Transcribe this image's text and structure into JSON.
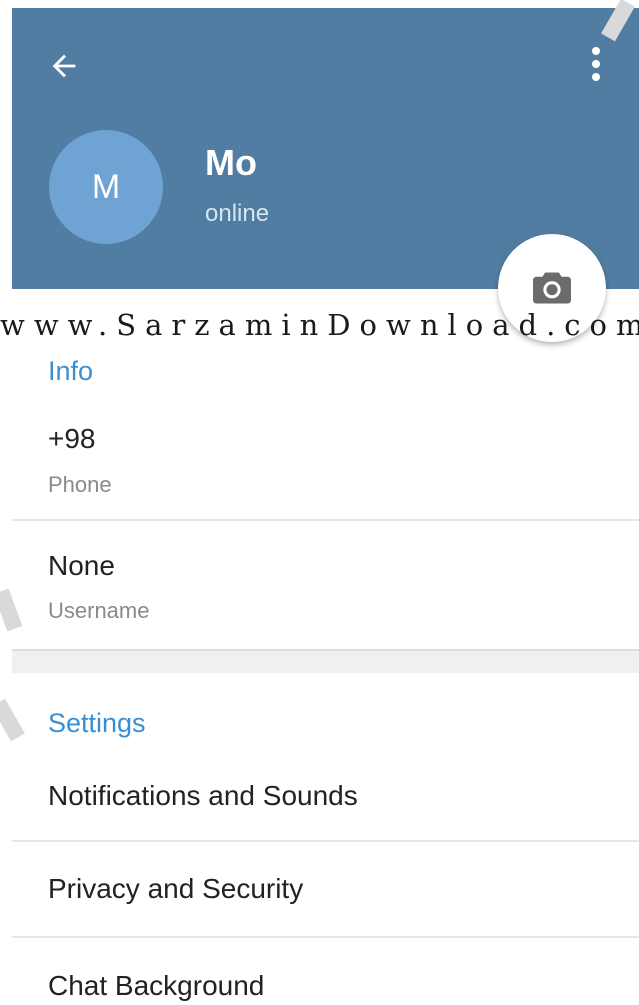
{
  "header": {
    "back_icon": "arrow-left-icon",
    "menu_icon": "more-vertical-icon",
    "avatar_initial": "M",
    "name": "Mo",
    "status": "online",
    "camera_icon": "camera-icon",
    "color": "#517da2"
  },
  "info": {
    "title": "Info",
    "phone": {
      "value": "+98",
      "label": "Phone"
    },
    "username": {
      "value": "None",
      "label": "Username"
    }
  },
  "settings": {
    "title": "Settings",
    "items": [
      {
        "label": "Notifications and Sounds"
      },
      {
        "label": "Privacy and Security"
      },
      {
        "label": "Chat Background"
      }
    ]
  },
  "watermark": "www.SarzaminDownload.com",
  "accent_color": "#3a8fd3"
}
